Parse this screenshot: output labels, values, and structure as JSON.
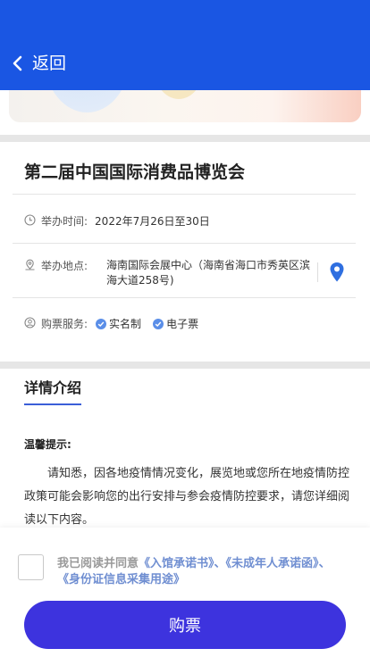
{
  "header": {
    "back_label": "返回",
    "bg_color": "#1a56e3"
  },
  "event": {
    "title": "第二届中国国际消费品博览会",
    "time_label": "举办时间:",
    "time_value": "2022年7月26日至30日",
    "location_label": "举办地点:",
    "location_value": "海南国际会展中心（海南省海口市秀英区滨海大道258号)",
    "service_label": "购票服务:",
    "services": [
      "实名制",
      "电子票"
    ]
  },
  "detail": {
    "section_title": "详情介绍",
    "tip_heading": "温馨提示:",
    "tip_text": "请知悉，因各地疫情情况变化，展览地或您所在地疫情防控政策可能会影响您的出行安排与参会疫情防控要求，请您详细阅读以下内容。"
  },
  "footer": {
    "agree_prefix": "我已阅读并同意",
    "link1": "《入馆承诺书》",
    "sep1": "、",
    "link2": "《未成年人承诺函》",
    "sep2": "、",
    "link3": "《身份证信息采集用途》",
    "buy_label": "购票",
    "buy_color": "#3d33de"
  },
  "icons": [
    "chevron-left-icon",
    "clock-icon",
    "location-outline-icon",
    "map-pin-icon",
    "user-circle-icon",
    "check-circle-icon"
  ]
}
